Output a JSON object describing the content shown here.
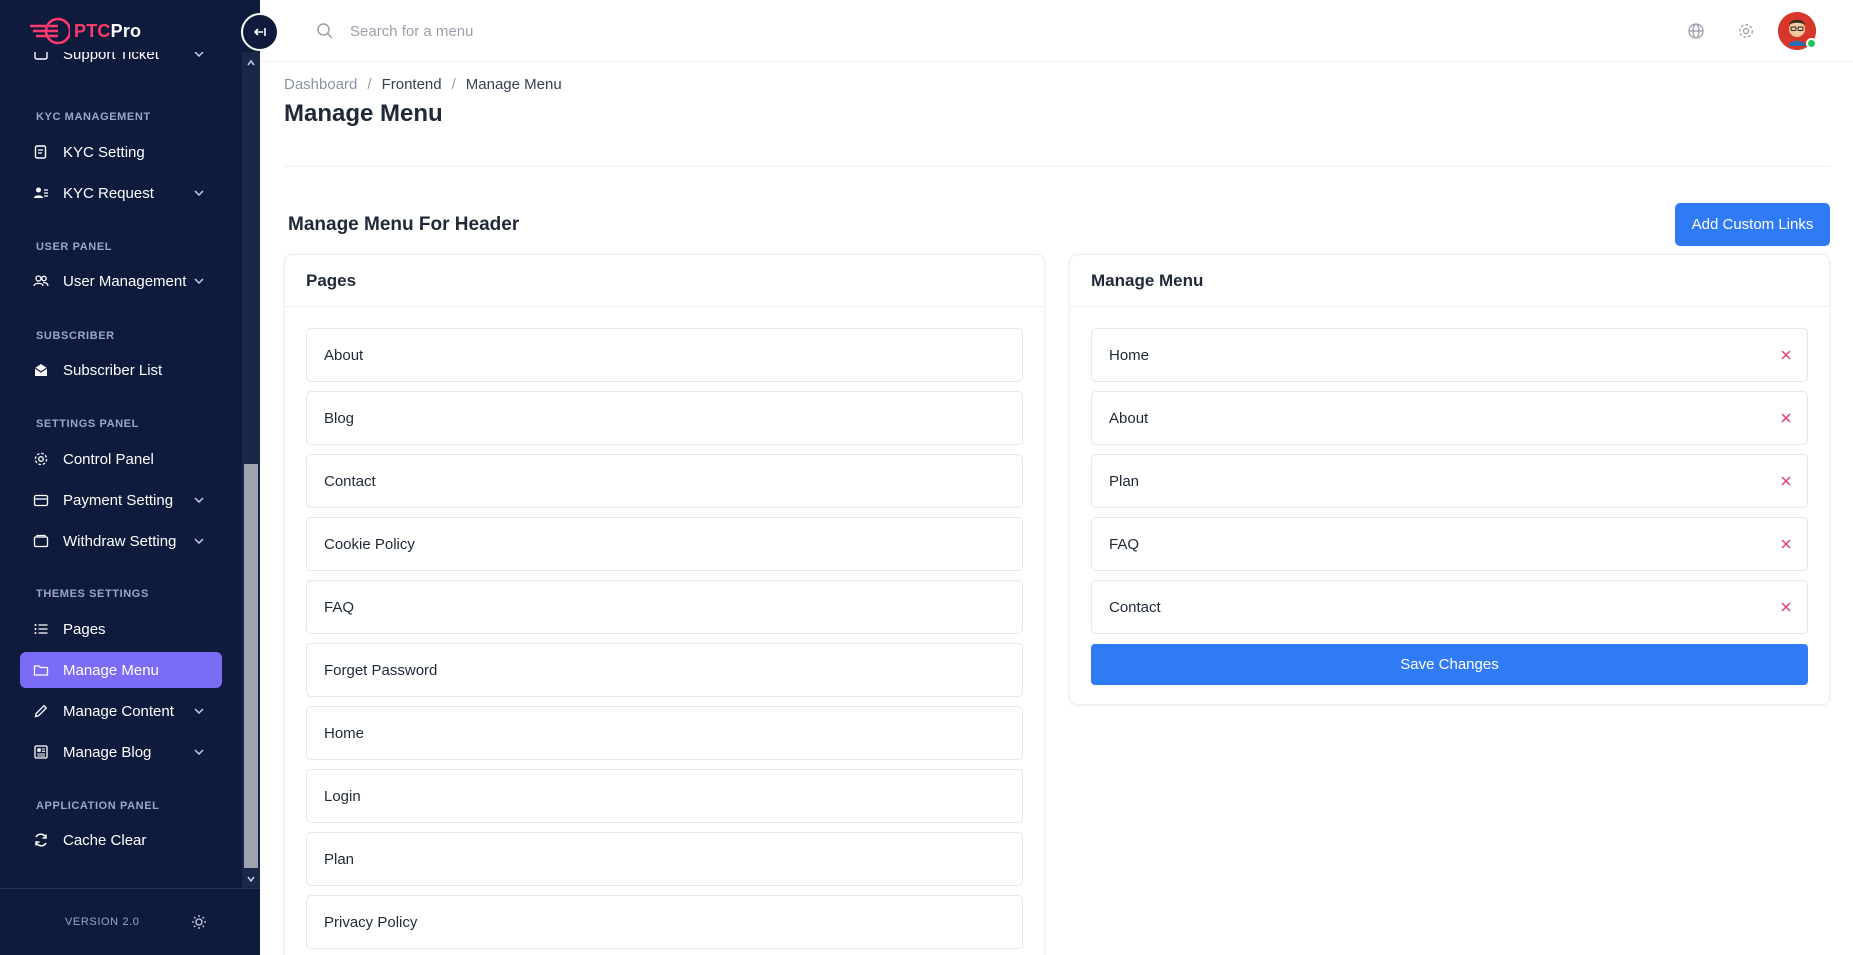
{
  "brand": {
    "part1": "PTC",
    "part2": "Pro"
  },
  "sidebar": {
    "sections": [
      {
        "title": "KYC MANAGEMENT"
      },
      {
        "title": "USER PANEL"
      },
      {
        "title": "SUBSCRIBER"
      },
      {
        "title": "SETTINGS PANEL"
      },
      {
        "title": "THEMES SETTINGS"
      },
      {
        "title": "APPLICATION PANEL"
      }
    ],
    "items": [
      {
        "label": "Support Ticket",
        "icon": "ticket-icon"
      },
      {
        "label": "KYC Setting",
        "icon": "kyc-setting-icon"
      },
      {
        "label": "KYC Request",
        "icon": "user-list-icon"
      },
      {
        "label": "User Management",
        "icon": "users-icon"
      },
      {
        "label": "Subscriber List",
        "icon": "envelope-icon"
      },
      {
        "label": "Control Panel",
        "icon": "gear-icon"
      },
      {
        "label": "Payment Setting",
        "icon": "wallet-icon"
      },
      {
        "label": "Withdraw Setting",
        "icon": "folder-icon"
      },
      {
        "label": "Pages",
        "icon": "list-icon"
      },
      {
        "label": "Manage Menu",
        "icon": "folder-open-icon"
      },
      {
        "label": "Manage Content",
        "icon": "pencil-icon"
      },
      {
        "label": "Manage Blog",
        "icon": "newspaper-icon"
      },
      {
        "label": "Cache Clear",
        "icon": "refresh-icon"
      }
    ],
    "version": "VERSION 2.0"
  },
  "search": {
    "placeholder": "Search for a menu"
  },
  "breadcrumb": {
    "items": [
      "Dashboard",
      "Frontend",
      "Manage Menu"
    ]
  },
  "page_title": "Manage Menu",
  "section_title": "Manage Menu For Header",
  "add_custom_links_label": "Add Custom Links",
  "pages_card": {
    "title": "Pages",
    "items": [
      "About",
      "Blog",
      "Contact",
      "Cookie Policy",
      "FAQ",
      "Forget Password",
      "Home",
      "Login",
      "Plan",
      "Privacy Policy"
    ]
  },
  "menu_card": {
    "title": "Manage Menu",
    "items": [
      "Home",
      "About",
      "Plan",
      "FAQ",
      "Contact"
    ],
    "save_label": "Save Changes"
  },
  "colors": {
    "sidebar_bg": "#0f1b3d",
    "active_item": "#7b6cf6",
    "primary_button": "#2f7af5",
    "remove_icon": "#e0406a",
    "status_online": "#22c55e"
  }
}
